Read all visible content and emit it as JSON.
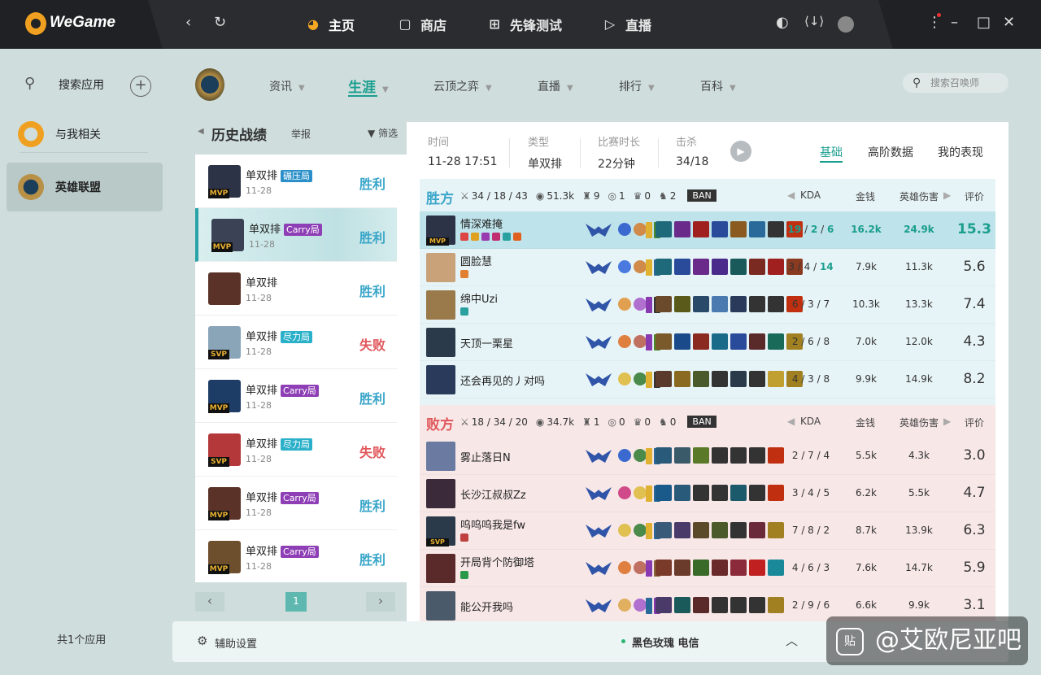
{
  "app": {
    "logo_text": "WeGame",
    "window_controls": {
      "menu": "⋮",
      "min": "–",
      "max": "□",
      "close": "✕"
    }
  },
  "topnav": [
    {
      "label": "主页",
      "icon": "pacman-icon"
    },
    {
      "label": "商店",
      "icon": "bag-icon"
    },
    {
      "label": "先锋测试",
      "icon": "ticket-icon"
    },
    {
      "label": "直播",
      "icon": "play-icon"
    }
  ],
  "sidebar": {
    "search_label": "搜索应用",
    "items": [
      {
        "label": "与我相关"
      },
      {
        "label": "英雄联盟"
      }
    ],
    "footer": "共1个应用"
  },
  "gamenav": [
    {
      "label": "资讯"
    },
    {
      "label": "生涯"
    },
    {
      "label": "云顶之弈"
    },
    {
      "label": "直播"
    },
    {
      "label": "排行"
    },
    {
      "label": "百科"
    }
  ],
  "search": {
    "placeholder": "搜索召唤师"
  },
  "history": {
    "title": "历史战绩",
    "report": "举报",
    "filter": "筛选",
    "matches": [
      {
        "mode": "单双排",
        "tag": "碾压局",
        "tag_color": "#2a8fc9",
        "date": "11-28",
        "result": "胜利",
        "badge": "MVP",
        "av": "#2c3346"
      },
      {
        "mode": "单双排",
        "tag": "Carry局",
        "tag_color": "#8e3fb5",
        "date": "11-28",
        "result": "胜利",
        "badge": "MVP",
        "av": "#3b4256"
      },
      {
        "mode": "单双排",
        "tag": "",
        "tag_color": "",
        "date": "11-28",
        "result": "胜利",
        "badge": "",
        "av": "#5a3228"
      },
      {
        "mode": "单双排",
        "tag": "尽力局",
        "tag_color": "#2ab0c9",
        "date": "11-28",
        "result": "失败",
        "badge": "SVP",
        "av": "#8aa4b8"
      },
      {
        "mode": "单双排",
        "tag": "Carry局",
        "tag_color": "#8e3fb5",
        "date": "11-28",
        "result": "胜利",
        "badge": "MVP",
        "av": "#1e3d66"
      },
      {
        "mode": "单双排",
        "tag": "尽力局",
        "tag_color": "#2ab0c9",
        "date": "11-28",
        "result": "失败",
        "badge": "SVP",
        "av": "#b4373a"
      },
      {
        "mode": "单双排",
        "tag": "Carry局",
        "tag_color": "#8e3fb5",
        "date": "11-28",
        "result": "胜利",
        "badge": "MVP",
        "av": "#5a3228"
      },
      {
        "mode": "单双排",
        "tag": "Carry局",
        "tag_color": "#8e3fb5",
        "date": "11-28",
        "result": "胜利",
        "badge": "MVP",
        "av": "#6d4e2d"
      }
    ],
    "page": "1"
  },
  "detail": {
    "meta": [
      {
        "k": "时间",
        "v": "11-28 17:51"
      },
      {
        "k": "类型",
        "v": "单双排"
      },
      {
        "k": "比赛时长",
        "v": "22分钟"
      },
      {
        "k": "击杀",
        "v": "34/18"
      }
    ],
    "tabs": [
      "基础",
      "高阶数据",
      "我的表现"
    ],
    "cols": {
      "kda": "KDA",
      "gold": "金钱",
      "dmg": "英雄伤害",
      "score": "评价"
    },
    "ban_label": "BAN",
    "win": {
      "name": "胜方",
      "kda": "34 / 18 / 43",
      "gold": "51.3k",
      "s1": "9",
      "s2": "1",
      "s3": "0",
      "s4": "2",
      "players": [
        {
          "name": "情深难掩",
          "kda": [
            "19",
            "2",
            "6"
          ],
          "gold": "16.2k",
          "dmg": "24.9k",
          "score": "15.3",
          "badge": "MVP",
          "hl": true,
          "av": "#2c3346",
          "subs": [
            "#d44",
            "#e0a020",
            "#9a3ab0",
            "#c03070",
            "#2aa0a0",
            "#e06020"
          ],
          "rune": [
            "#3a6ad0",
            "#d08a4a"
          ],
          "summ": [
            "#e0b030",
            "#4a8a2a"
          ],
          "items": [
            "#1f6a7a",
            "#6a2a8a",
            "#a02020",
            "#2a4a9a",
            "#8a5a20",
            "#2a6a9a",
            "#333",
            "#c03010"
          ]
        },
        {
          "name": "圆脸慧",
          "kda": [
            "3",
            "4",
            "14"
          ],
          "gold": "7.9k",
          "dmg": "11.3k",
          "score": "5.6",
          "badge": "",
          "hl": false,
          "av": "#caa27a",
          "subs": [
            "#e08030"
          ],
          "rune": [
            "#4a7ae0",
            "#d08a4a"
          ],
          "summ": [
            "#e0b030",
            "#2a6a9a"
          ],
          "items": [
            "#1f6a7a",
            "#2a4a9a",
            "#6a2a8a",
            "#4a2a8a",
            "#1a5a5a",
            "#7a2a20",
            "#a02020",
            "#8a3a20"
          ]
        },
        {
          "name": "绵中Uzi",
          "kda": [
            "6",
            "3",
            "7"
          ],
          "gold": "10.3k",
          "dmg": "13.3k",
          "score": "7.4",
          "badge": "",
          "hl": false,
          "av": "#9a7a4a",
          "subs": [
            "#2aa0a0"
          ],
          "rune": [
            "#e0a050",
            "#b070d0"
          ],
          "summ": [
            "#8a3ab0",
            "#333"
          ],
          "items": [
            "#6a4a2a",
            "#5a5a1a",
            "#2a4a6a",
            "#4a7ab0",
            "#2a3a5a",
            "#333",
            "#333",
            "#c03010"
          ]
        },
        {
          "name": "天顶一栗星",
          "kda": [
            "2",
            "6",
            "8"
          ],
          "gold": "7.0k",
          "dmg": "12.0k",
          "score": "4.3",
          "badge": "",
          "hl": false,
          "av": "#2a3a4a",
          "subs": [],
          "rune": [
            "#e08040",
            "#c07060"
          ],
          "summ": [
            "#8a3ab0",
            "#4a8a2a"
          ],
          "items": [
            "#7a5a2a",
            "#1a4a8a",
            "#8a2a20",
            "#1a6a8a",
            "#2a4a9a",
            "#5a2a2a",
            "#1a6a5a",
            "#a08020"
          ]
        },
        {
          "name": "还会再见的丿对吗",
          "kda": [
            "4",
            "3",
            "8"
          ],
          "gold": "9.9k",
          "dmg": "14.9k",
          "score": "8.2",
          "badge": "",
          "hl": false,
          "av": "#2a3a5a",
          "subs": [],
          "rune": [
            "#e0c050",
            "#4a8a4a"
          ],
          "summ": [
            "#e0b030",
            "#333"
          ],
          "items": [
            "#5a3a2a",
            "#8a6a20",
            "#4a5a2a",
            "#333",
            "#2a3a4a",
            "#333",
            "#c0a030",
            "#a08020"
          ]
        }
      ]
    },
    "lose": {
      "name": "败方",
      "kda": "18 / 34 / 20",
      "gold": "34.7k",
      "s1": "1",
      "s2": "0",
      "s3": "0",
      "s4": "0",
      "players": [
        {
          "name": "雾止落日N",
          "kda": [
            "2",
            "7",
            "4"
          ],
          "gold": "5.5k",
          "dmg": "4.3k",
          "score": "3.0",
          "badge": "",
          "hl": false,
          "av": "#6a7aa0",
          "subs": [],
          "rune": [
            "#3a6ad0",
            "#4a8a4a"
          ],
          "summ": [
            "#e0b030",
            "#2a6a9a"
          ],
          "items": [
            "#2a5a7a",
            "#3a5a6a",
            "#5a7a2a",
            "#333",
            "#333",
            "#333",
            "#c03010"
          ]
        },
        {
          "name": "长沙江叔叔Zz",
          "kda": [
            "3",
            "4",
            "5"
          ],
          "gold": "6.2k",
          "dmg": "5.5k",
          "score": "4.7",
          "badge": "",
          "hl": false,
          "av": "#3a2a3a",
          "subs": [],
          "rune": [
            "#d04a8a",
            "#e0c050"
          ],
          "summ": [
            "#e0b030",
            "#2a6a9a"
          ],
          "items": [
            "#1a5a8a",
            "#2a5a7a",
            "#333",
            "#333",
            "#1a5a6a",
            "#333",
            "#c03010"
          ]
        },
        {
          "name": "呜呜呜我是fw",
          "kda": [
            "7",
            "8",
            "2"
          ],
          "gold": "8.7k",
          "dmg": "13.9k",
          "score": "6.3",
          "badge": "SVP",
          "hl": false,
          "av": "#2a3a4a",
          "subs": [
            "#c04040"
          ],
          "rune": [
            "#e0c050",
            "#4a8a4a"
          ],
          "summ": [
            "#e0b030",
            "#2a6a9a"
          ],
          "items": [
            "#3a5a7a",
            "#4a3a6a",
            "#5a4a2a",
            "#4a5a2a",
            "#333",
            "#6a2a3a",
            "#a08020"
          ]
        },
        {
          "name": "开局背个防御塔",
          "kda": [
            "4",
            "6",
            "3"
          ],
          "gold": "7.6k",
          "dmg": "14.7k",
          "score": "5.9",
          "badge": "",
          "hl": false,
          "av": "#5a2a2a",
          "subs": [
            "#2a9a4a"
          ],
          "rune": [
            "#e08040",
            "#c07060"
          ],
          "summ": [
            "#8a3ab0",
            "#8a6a3a"
          ],
          "items": [
            "#7a3a2a",
            "#6a3a2a",
            "#3a6a2a",
            "#6a2a2a",
            "#8a2a3a",
            "#c02020",
            "#1a8a9a"
          ]
        },
        {
          "name": "能公开我吗",
          "kda": [
            "2",
            "9",
            "6"
          ],
          "gold": "6.6k",
          "dmg": "9.9k",
          "score": "3.1",
          "badge": "",
          "hl": false,
          "av": "#4a5a6a",
          "subs": [],
          "rune": [
            "#e0b060",
            "#b070d0"
          ],
          "summ": [
            "#2a6a9a",
            "#8a3ab0"
          ],
          "items": [
            "#4a3a6a",
            "#1a5a5a",
            "#5a2a2a",
            "#333",
            "#333",
            "#333",
            "#a08020"
          ]
        }
      ]
    }
  },
  "bottom": {
    "settings": "辅助设置",
    "server": "黑色玫瑰 电信"
  },
  "watermark": "@艾欧尼亚吧",
  "colors": {
    "accent": "#1a9e8e",
    "win": "#3aa6c9",
    "lose": "#e0565a",
    "win_bg": "#e6f4f7",
    "lose_bg": "#f8e6e6"
  }
}
